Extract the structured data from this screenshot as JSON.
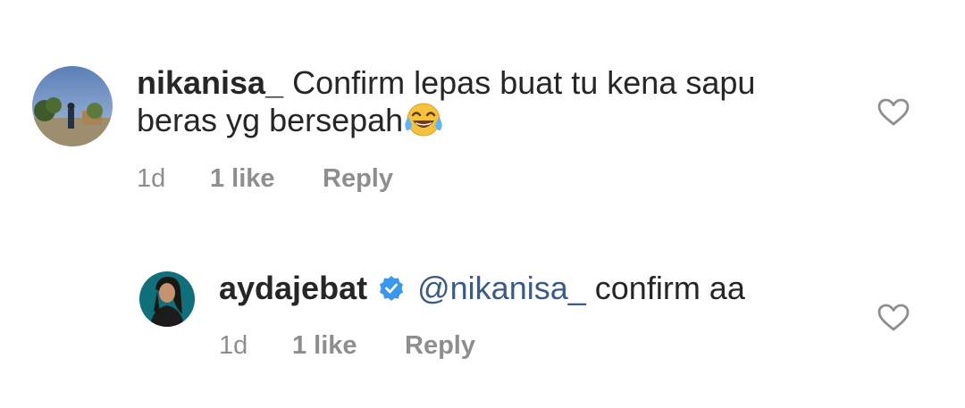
{
  "comments": [
    {
      "username": "nikanisa_",
      "text_line1": "Confirm lepas buat tu kena sapu",
      "text_line2": "beras yg bersepah",
      "emoji": "face-with-tears-of-joy",
      "time": "1d",
      "likes": "1 like",
      "reply_label": "Reply"
    },
    {
      "username": "aydajebat",
      "verified": true,
      "mention": "@nikanisa_",
      "text": "confirm aa",
      "time": "1d",
      "likes": "1 like",
      "reply_label": "Reply"
    }
  ],
  "colors": {
    "text": "#262626",
    "meta": "#8e8e8e",
    "mention": "#3d5a86",
    "verified": "#3897f0"
  }
}
